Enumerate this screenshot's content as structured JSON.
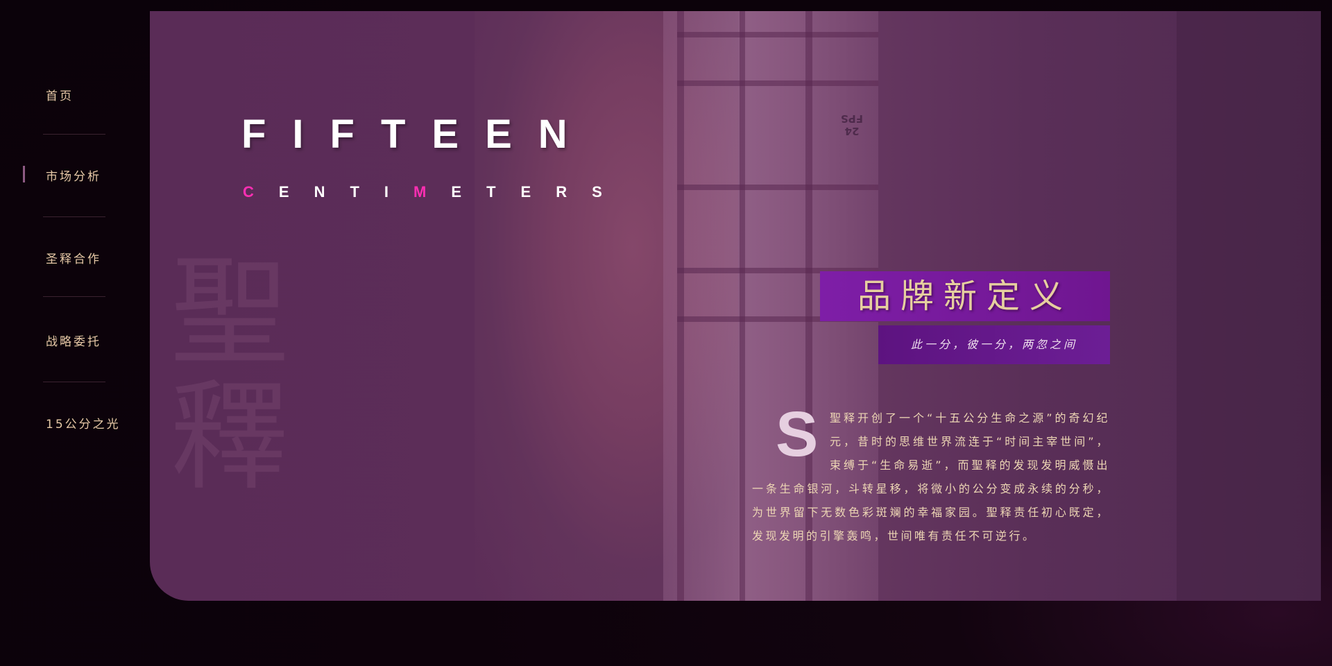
{
  "sidebar": {
    "items": [
      {
        "label": "首页"
      },
      {
        "label": "市场分析"
      },
      {
        "label": "圣释合作"
      },
      {
        "label": "战略委托"
      },
      {
        "label": "15公分之光"
      }
    ]
  },
  "hero": {
    "watermark": "聖釋",
    "title": "FIFTEEN",
    "subtitle_letters": [
      "C",
      "E",
      "N",
      "T",
      "I",
      "M",
      "E",
      "T",
      "E",
      "R",
      "S"
    ],
    "subtitle_accent_letters": [
      "C",
      "M"
    ],
    "fps_badge": "24 FPS",
    "brand_headline": "品牌新定义",
    "tagline": "此一分，彼一分，两忽之间",
    "dropcap": "S",
    "body_text": "聖释开创了一个“十五公分生命之源”的奇幻纪元，昔时的思维世界流连于“时间主宰世间”，束缚于“生命易逝”，而聖释的发现发明威慑出一条生命银河，斗转星移，将微小的公分变成永续的分秒，为世界留下无数色彩斑斓的幸福家园。聖释责任初心既定，发现发明的引擎轰鸣，世间唯有责任不可逆行。"
  },
  "colors": {
    "page_background": "#0b020a",
    "card_background": "#5c2d58",
    "accent_pink": "#ff2fb3",
    "brand_purple": "#7e1ea7",
    "gold_text": "#e6c9a6"
  }
}
